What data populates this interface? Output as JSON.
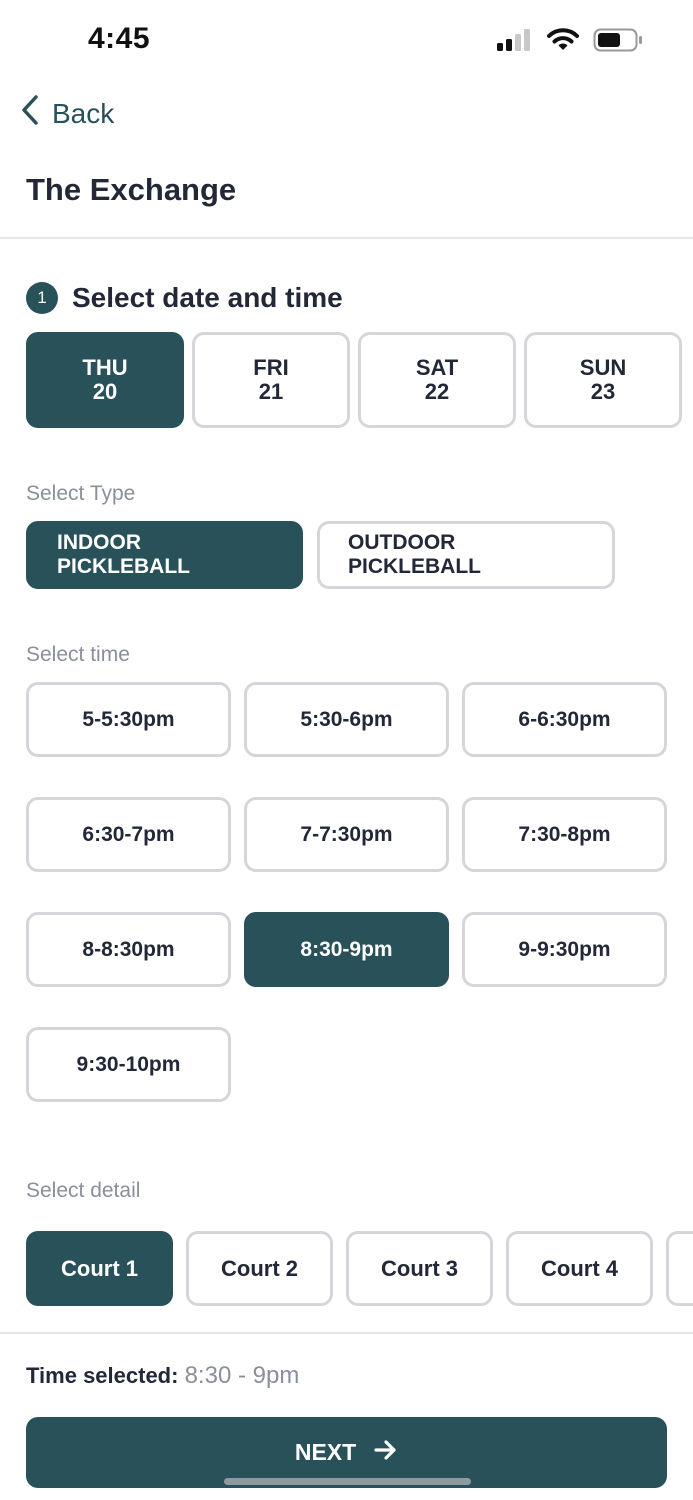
{
  "status_bar": {
    "time": "4:45"
  },
  "header": {
    "back_label": "Back",
    "title": "The Exchange"
  },
  "step": {
    "number": "1",
    "title": "Select date and time"
  },
  "dates": [
    {
      "day": "THU",
      "date": "20",
      "selected": true
    },
    {
      "day": "FRI",
      "date": "21",
      "selected": false
    },
    {
      "day": "SAT",
      "date": "22",
      "selected": false
    },
    {
      "day": "SUN",
      "date": "23",
      "selected": false
    }
  ],
  "type_section": {
    "label": "Select Type",
    "options": [
      "INDOOR PICKLEBALL",
      "OUTDOOR PICKLEBALL"
    ],
    "selected_index": 0
  },
  "time_section": {
    "label": "Select time",
    "slots": [
      "5-5:30pm",
      "5:30-6pm",
      "6-6:30pm",
      "6:30-7pm",
      "7-7:30pm",
      "7:30-8pm",
      "8-8:30pm",
      "8:30-9pm",
      "9-9:30pm",
      "9:30-10pm"
    ],
    "selected_index": 7
  },
  "detail_section": {
    "label": "Select detail",
    "courts": [
      "Court 1",
      "Court 2",
      "Court 3",
      "Court 4",
      ""
    ],
    "selected_index": 0
  },
  "footer": {
    "time_selected_label": "Time selected:",
    "time_selected_value": "8:30 - 9pm",
    "next_label": "NEXT"
  },
  "colors": {
    "accent": "#285159",
    "border": "#d4d6da",
    "muted": "#8a8f9a"
  },
  "icons": {
    "back": "chevron-left-icon",
    "next": "arrow-right-icon",
    "signal": "cellular-signal-icon",
    "wifi": "wifi-icon",
    "battery": "battery-icon"
  }
}
